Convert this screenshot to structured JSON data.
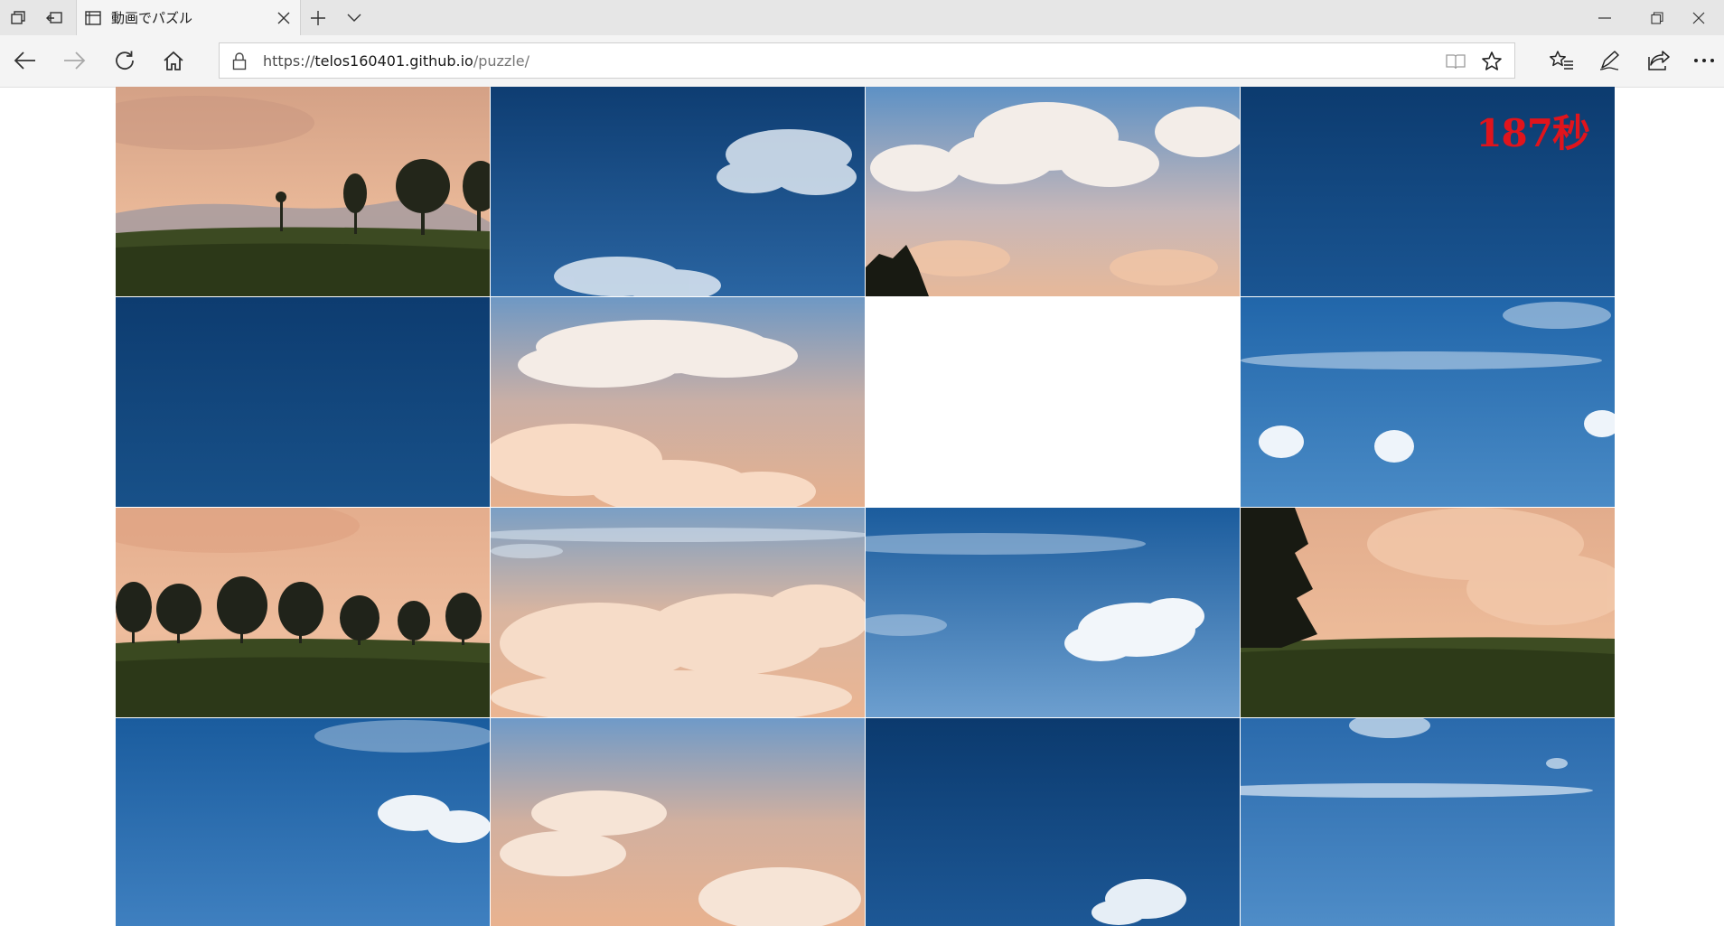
{
  "browser": {
    "tab": {
      "title": "動画でパズル",
      "favicon": "page-icon"
    },
    "titlebar_icons": [
      "tab-manager-icon",
      "set-aside-tabs-icon"
    ],
    "tab_controls": [
      "new-tab-icon",
      "tab-preview-chevron-icon"
    ],
    "window_controls": [
      "minimize-icon",
      "restore-icon",
      "close-icon"
    ],
    "nav": [
      "back-arrow-icon",
      "forward-arrow-icon",
      "refresh-icon",
      "home-icon"
    ],
    "address": {
      "scheme": "https://",
      "host": "telos160401.github.io",
      "path": "/puzzle/",
      "icons": [
        "lock-icon",
        "reading-view-icon",
        "favorite-star-icon"
      ]
    },
    "toolbar": [
      "favorites-hub-icon",
      "pen-notes-icon",
      "share-icon",
      "more-dots-icon"
    ]
  },
  "colors": {
    "timer": "#e0141c",
    "sky_dark": "#0f3f73",
    "sky_mid": "#2b6fad",
    "sky_light": "#5b95cc",
    "sunset_peach": "#e8b08e",
    "grass": "#2e3a1a"
  },
  "puzzle": {
    "timer": "187秒",
    "grid": "4x4",
    "empty_slot": "row 2, column 3",
    "tiles": [
      {
        "row": 1,
        "col": 1,
        "scene": "peach sunset sky, hills, trees on green field"
      },
      {
        "row": 1,
        "col": 2,
        "scene": "dark blue sky with white clouds"
      },
      {
        "row": 1,
        "col": 3,
        "scene": "light blue sky with cumulus clouds, tree corner"
      },
      {
        "row": 1,
        "col": 4,
        "scene": "dark blue sky"
      },
      {
        "row": 2,
        "col": 1,
        "scene": "dark blue sky"
      },
      {
        "row": 2,
        "col": 2,
        "scene": "peach sky with large clouds"
      },
      {
        "row": 2,
        "col": 3,
        "scene": "empty"
      },
      {
        "row": 2,
        "col": 4,
        "scene": "blue sky with small clouds"
      },
      {
        "row": 3,
        "col": 1,
        "scene": "peach sky with tree row on green field"
      },
      {
        "row": 3,
        "col": 2,
        "scene": "peach clouds"
      },
      {
        "row": 3,
        "col": 3,
        "scene": "blue sky with white cloud"
      },
      {
        "row": 3,
        "col": 4,
        "scene": "peach sky with large tree and field"
      },
      {
        "row": 4,
        "col": 1,
        "scene": "blue sky with white cloud"
      },
      {
        "row": 4,
        "col": 2,
        "scene": "peach clouds"
      },
      {
        "row": 4,
        "col": 3,
        "scene": "dark blue sky with small cloud"
      },
      {
        "row": 4,
        "col": 4,
        "scene": "light blue sky"
      }
    ]
  }
}
